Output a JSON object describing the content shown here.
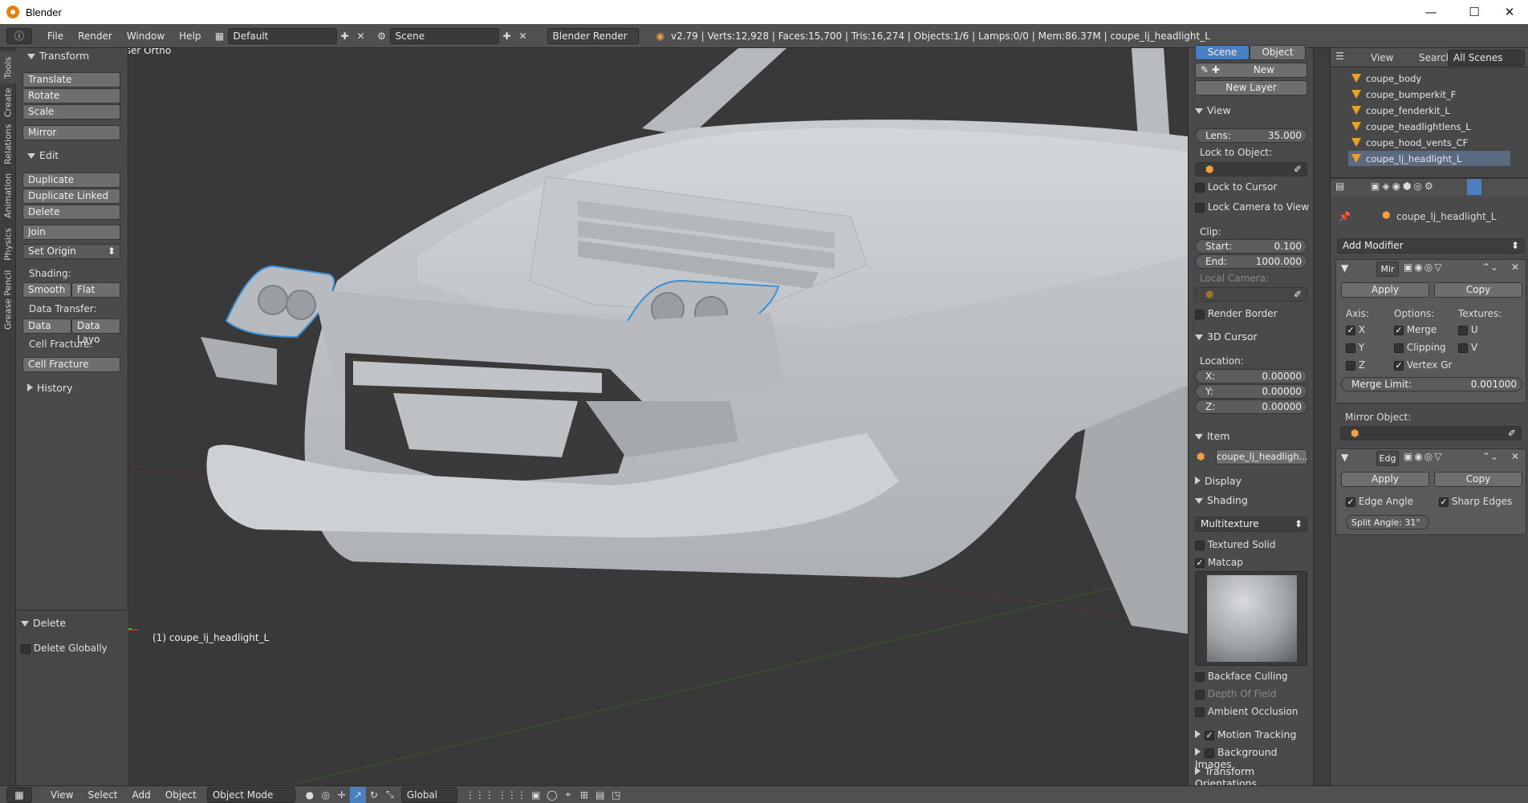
{
  "window": {
    "title": "Blender",
    "minimize": "—",
    "maximize": "☐",
    "close": "✕"
  },
  "info_header": {
    "menus": [
      "File",
      "Render",
      "Window",
      "Help"
    ],
    "screen_layout": "Default",
    "scene": "Scene",
    "render_engine": "Blender Render",
    "stats": "v2.79 | Verts:12,928 | Faces:15,700 | Tris:16,274 | Objects:1/6 | Lamps:0/0 | Mem:86.37M | coupe_lj_headlight_L"
  },
  "tool_tabs": [
    "Tools",
    "Create",
    "Relations",
    "Animation",
    "Physics",
    "Grease Pencil"
  ],
  "toolshelf": {
    "transform": {
      "title": "Transform",
      "buttons": [
        "Translate",
        "Rotate",
        "Scale",
        "Mirror"
      ]
    },
    "edit": {
      "title": "Edit",
      "buttons": [
        "Duplicate",
        "Duplicate Linked",
        "Delete",
        "Join"
      ],
      "set_origin": "Set Origin",
      "shading_label": "Shading:",
      "smooth": "Smooth",
      "flat": "Flat",
      "data_transfer_label": "Data Transfer:",
      "data": "Data",
      "data_layo": "Data Layo",
      "cell_fracture_label": "Cell Fracture:",
      "cell_fracture": "Cell Fracture"
    },
    "history": "History",
    "operator": {
      "title": "Delete",
      "delete_globally": "Delete Globally"
    }
  },
  "viewport": {
    "view_name": "User Ortho",
    "object_label": "(1) coupe_lj_headlight_L"
  },
  "npanel": {
    "tab_scene": "Scene",
    "tab_object": "Object",
    "new": "New",
    "new_layer": "New Layer",
    "view": {
      "title": "View",
      "lens_label": "Lens:",
      "lens_value": "35.000",
      "lock_to_object": "Lock to Object:",
      "lock_to_cursor": "Lock to Cursor",
      "lock_camera": "Lock Camera to View",
      "clip": "Clip:",
      "start_label": "Start:",
      "start_value": "0.100",
      "end_label": "End:",
      "end_value": "1000.000",
      "local_camera": "Local Camera:",
      "render_border": "Render Border"
    },
    "cursor": {
      "title": "3D Cursor",
      "location": "Location:",
      "x_label": "X:",
      "x": "0.00000",
      "y_label": "Y:",
      "y": "0.00000",
      "z_label": "Z:",
      "z": "0.00000"
    },
    "item": {
      "title": "Item",
      "name": "coupe_lj_headligh..."
    },
    "display": "Display",
    "shading": {
      "title": "Shading",
      "mode": "Multitexture",
      "textured_solid": "Textured Solid",
      "matcap": "Matcap",
      "backface": "Backface Culling",
      "dof": "Depth Of Field",
      "ao": "Ambient Occlusion"
    },
    "motion_tracking": "Motion Tracking",
    "background_images": "Background Images",
    "transform_orientations": "Transform Orientations"
  },
  "outliner": {
    "menus": [
      "View",
      "Search"
    ],
    "filter": "All Scenes",
    "items": [
      "coupe_body",
      "coupe_bumperkit_F",
      "coupe_fenderkit_L",
      "coupe_headlightlens_L",
      "coupe_hood_vents_CF",
      "coupe_lj_headlight_L"
    ]
  },
  "properties": {
    "object_name": "coupe_lj_headlight_L",
    "add_modifier": "Add Modifier",
    "mirror": {
      "name": "Mir",
      "apply": "Apply",
      "copy": "Copy",
      "axis": "Axis:",
      "options": "Options:",
      "textures": "Textures:",
      "x": "X",
      "y": "Y",
      "z": "Z",
      "merge": "Merge",
      "clipping": "Clipping",
      "vertex_gr": "Vertex Gr",
      "u": "U",
      "v": "V",
      "merge_limit_label": "Merge Limit:",
      "merge_limit": "0.001000",
      "mirror_object": "Mirror Object:"
    },
    "edge": {
      "name": "Edg",
      "apply": "Apply",
      "copy": "Copy",
      "edge_angle": "Edge Angle",
      "sharp_edges": "Sharp Edges",
      "split_angle": "Split Angle: 31°"
    }
  },
  "bottom_header": {
    "menus": [
      "View",
      "Select",
      "Add",
      "Object"
    ],
    "mode": "Object Mode",
    "orientation": "Global"
  }
}
